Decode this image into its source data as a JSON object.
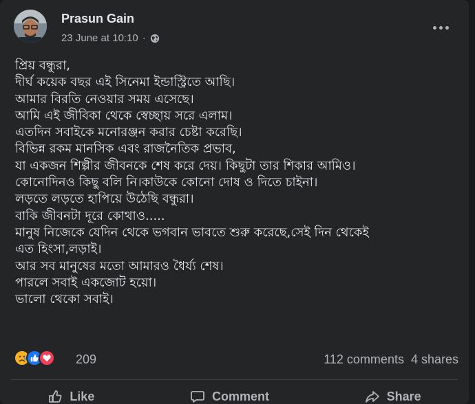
{
  "post": {
    "author": "Prasun Gain",
    "timestamp": "23 June at 10:10",
    "separator": "·",
    "privacy_icon": "globe-icon",
    "more_icon": "more-options-icon",
    "text": "প্রিয় বন্ধুরা,\nদীর্ঘ কয়েক বছর এই সিনেমা ইন্ডাস্ট্রিতে আছি।\nআমার বিরতি নেওয়ার সময় এসেছে।\nআমি এই জীবিকা থেকে স্বেচ্ছায় সরে এলাম।\nএতদিন সবাইকে মনোরঞ্জন করার চেষ্টা করেছি।\nবিভিন্ন রকম মানসিক এবং রাজনৈতিক প্রভাব,\nযা একজন শিল্পীর জীবনকে শেষ করে দেয়। কিছুটা তার শিকার আমিও।\nকোনোদিনও কিছু বলি নি।কাউকে কোনো দোষ ও দিতে চাইনা।\nলড়তে লড়তে হাপিয়ে উঠেছি বন্ধুরা।\nবাকি জীবনটা দূরে কোথাও.....\nমানুষ নিজেকে যেদিন থেকে ভগবান ভাবতে শুরু করেছে,সেই দিন থেকেই\nএত হিংসা,লড়াই।\nআর সব মানুষের মতো আমারও ধৈর্য্য শেষ।\nপারলে সবাই একজোট হয়ো।\nভালো থেকো সবাই।"
  },
  "reactions": {
    "icons": [
      "sad-reaction-icon",
      "like-reaction-icon",
      "love-reaction-icon"
    ],
    "count": "209"
  },
  "stats": {
    "comments": "112 comments",
    "shares": "4 shares"
  },
  "actions": {
    "like": "Like",
    "comment": "Comment",
    "share": "Share"
  },
  "colors": {
    "card_bg": "#242526",
    "text": "#e4e6eb",
    "muted": "#b0b3b8",
    "like_blue": "#1877f2",
    "love_red": "#f33e58",
    "sad_yellow": "#f7b125"
  }
}
